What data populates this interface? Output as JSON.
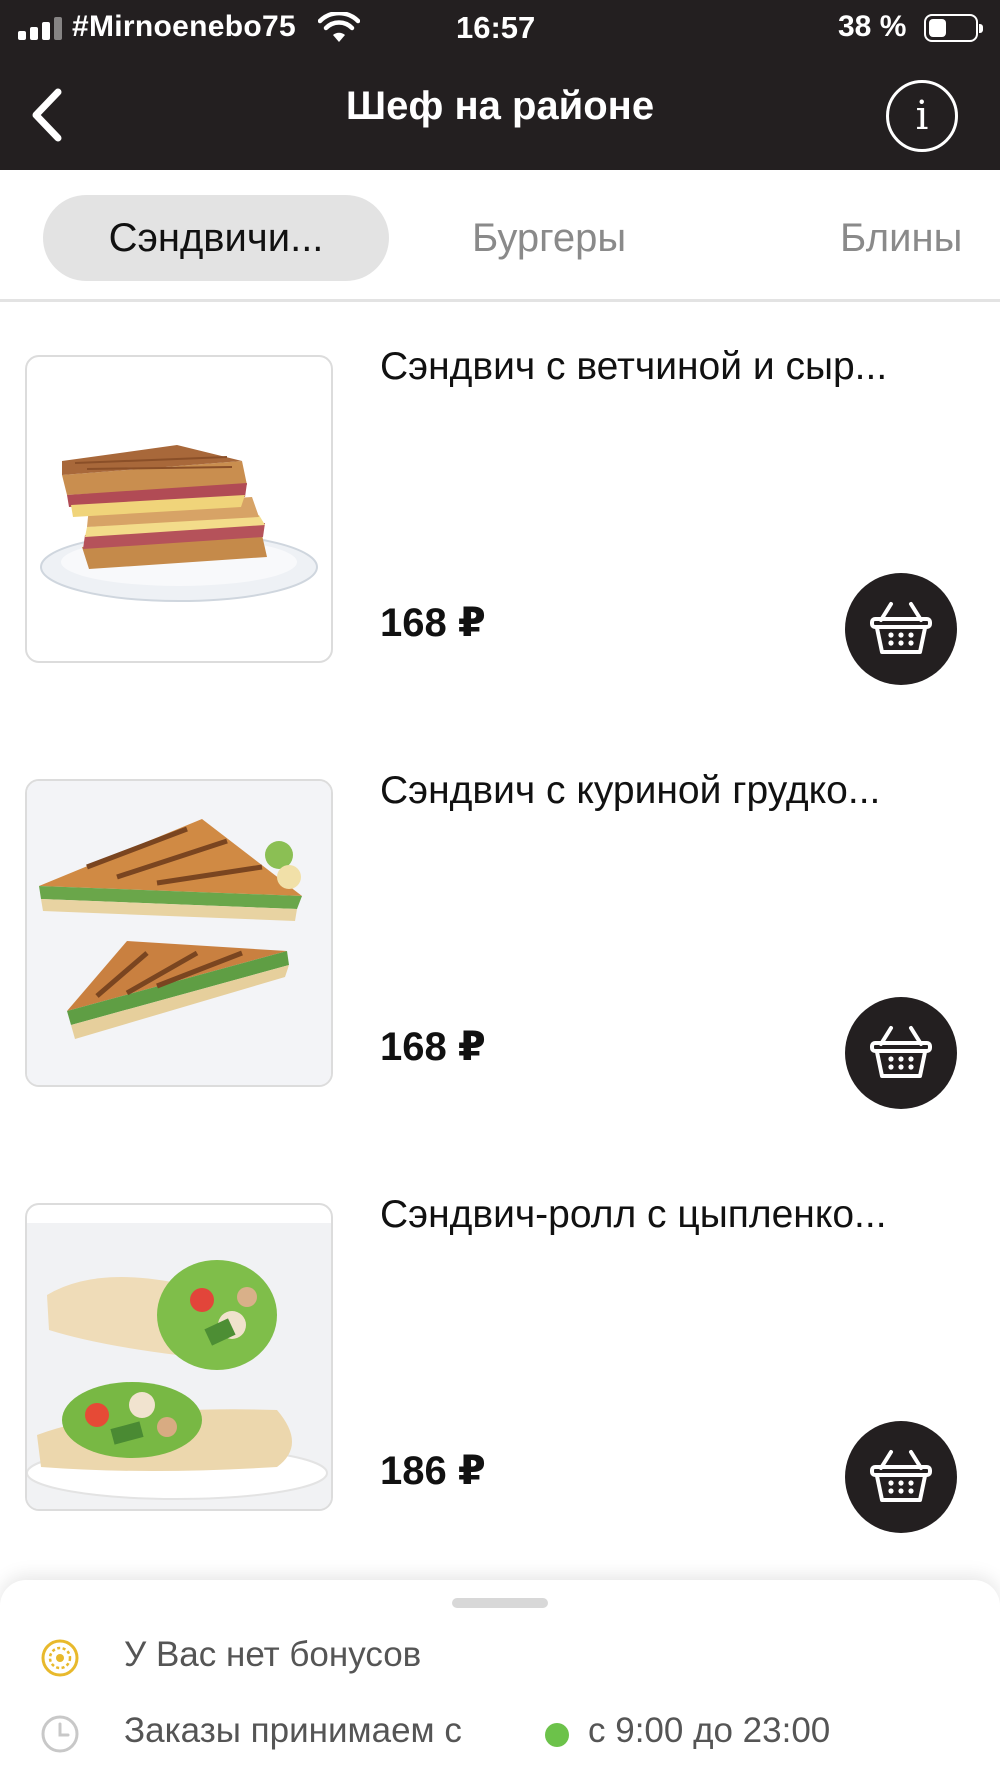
{
  "status_bar": {
    "carrier": "#Mirnoenebo75",
    "time": "16:57",
    "battery": "38 %",
    "battery_level": 0.38
  },
  "header": {
    "title": "Шеф на районе",
    "back_icon": "chevron-left-icon",
    "info_icon": "info-icon",
    "info_glyph": "i"
  },
  "tabs": [
    {
      "label": "Сэндвичи...",
      "active": true
    },
    {
      "label": "Бургеры",
      "active": false
    },
    {
      "label": "Блины",
      "active": false
    }
  ],
  "products": [
    {
      "title": "Сэндвич с ветчиной и сыр...",
      "price": "168 ₽",
      "cart_icon": "basket-icon"
    },
    {
      "title": "Сэндвич с куриной грудко...",
      "price": "168 ₽",
      "cart_icon": "basket-icon"
    },
    {
      "title": "Сэндвич-ролл с цыпленко...",
      "price": "186 ₽",
      "cart_icon": "basket-icon"
    }
  ],
  "sheet": {
    "bonus_text": "У Вас нет бонусов",
    "orders_text": "Заказы принимаем с",
    "hours": "с 9:00 до 23:00",
    "open_status_color": "#6cc24a",
    "bonus_icon_color": "#e8b92c"
  },
  "colors": {
    "header_bg": "#231f20",
    "tab_active_bg": "#e3e3e3",
    "muted_text": "#8a8a8a"
  }
}
